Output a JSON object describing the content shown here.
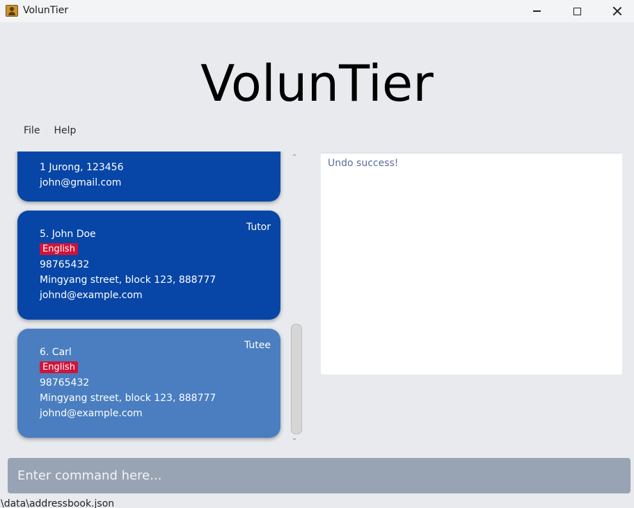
{
  "window": {
    "title": "VolunTier"
  },
  "brand": {
    "title": "VolunTier"
  },
  "menu": {
    "items": [
      "File",
      "Help"
    ]
  },
  "person_list": [
    {
      "address": "1 Jurong, 123456",
      "email": "john@gmail.com"
    },
    {
      "index_name": "5. John Doe",
      "role": "Tutor",
      "tag": "English",
      "phone": "98765432",
      "address": "Mingyang street, block 123, 888777",
      "email": "johnd@example.com"
    },
    {
      "index_name": "6. Carl",
      "role": "Tutee",
      "tag": "English",
      "phone": "98765432",
      "address": "Mingyang street, block 123, 888777",
      "email": "johnd@example.com"
    }
  ],
  "result": {
    "text": "Undo success!"
  },
  "command": {
    "placeholder": "Enter command here..."
  },
  "status": {
    "path": "\\data\\addressbook.json"
  },
  "colors": {
    "card_dark": "#0746a6",
    "card_selected": "#4a7ec0",
    "tag": "#d0133a",
    "command_bar": "#98a3b4"
  }
}
